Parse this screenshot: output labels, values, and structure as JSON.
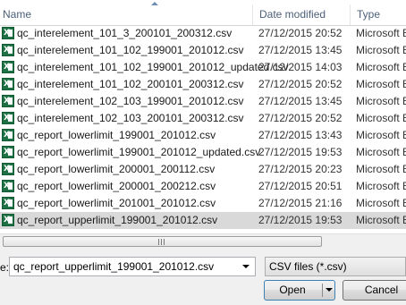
{
  "columns": {
    "name": "Name",
    "date_modified": "Date modified",
    "type": "Type"
  },
  "files": [
    {
      "name": "qc_interelement_101_3_200101_200312.csv",
      "date": "27/12/2015 20:52",
      "type": "Microsoft E"
    },
    {
      "name": "qc_interelement_101_102_199001_201012.csv",
      "date": "27/12/2015 13:45",
      "type": "Microsoft E"
    },
    {
      "name": "qc_interelement_101_102_199001_201012_updated.csv",
      "date": "27/12/2015 14:03",
      "type": "Microsoft E"
    },
    {
      "name": "qc_interelement_101_102_200101_200312.csv",
      "date": "27/12/2015 20:52",
      "type": "Microsoft E"
    },
    {
      "name": "qc_interelement_102_103_199001_201012.csv",
      "date": "27/12/2015 13:45",
      "type": "Microsoft E"
    },
    {
      "name": "qc_interelement_102_103_200101_200312.csv",
      "date": "27/12/2015 20:52",
      "type": "Microsoft E"
    },
    {
      "name": "qc_report_lowerlimit_199001_201012.csv",
      "date": "27/12/2015 13:43",
      "type": "Microsoft E"
    },
    {
      "name": "qc_report_lowerlimit_199001_201012_updated.csv",
      "date": "27/12/2015 19:53",
      "type": "Microsoft E"
    },
    {
      "name": "qc_report_lowerlimit_200001_200112.csv",
      "date": "27/12/2015 20:23",
      "type": "Microsoft E"
    },
    {
      "name": "qc_report_lowerlimit_200001_200212.csv",
      "date": "27/12/2015 20:51",
      "type": "Microsoft E"
    },
    {
      "name": "qc_report_lowerlimit_201001_201012.csv",
      "date": "27/12/2015 21:16",
      "type": "Microsoft E"
    },
    {
      "name": "qc_report_upperlimit_199001_201012.csv",
      "date": "27/12/2015 19:53",
      "type": "Microsoft E"
    }
  ],
  "selected_index": 11,
  "file_name_label": "e:",
  "file_name_value": "qc_report_upperlimit_199001_201012.csv",
  "file_type_value": "CSV files (*.csv)",
  "open_label": "Open",
  "cancel_label": "Cancel",
  "file_icon": "excel-csv-icon"
}
